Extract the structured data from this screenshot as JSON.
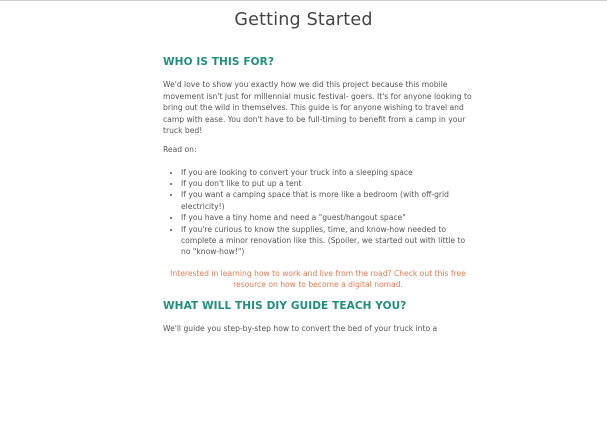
{
  "page": {
    "title": "Getting Started"
  },
  "section1": {
    "heading": "WHO IS THIS FOR?",
    "intro": "We'd love to show you exactly how we did this project because this mobile movement isn't just for millennial music festival- goers. It's for anyone looking to bring out the wild in themselves. This guide is for anyone wishing to travel and camp with ease. You don't have to be full-timing to benefit from a camp in your truck bed!",
    "read_on": "Read on:",
    "bullets": [
      "If you are looking to convert your truck into a sleeping space",
      "If you don't like to put up a tent",
      "If you want a camping space that is more like a bedroom (with off-grid electricity!)",
      "If you have a tiny home and need a \"guest/hangout space\"",
      "If you're curious to know the supplies, time, and know-how needed to complete a minor renovation like this. (Spoiler, we started out with little to no \"know-how!\")"
    ],
    "promo_link": "Interested in learning how to work and live from the road? Check out this free resource on how to become a digital nomad."
  },
  "section2": {
    "heading": "WHAT WILL THIS DIY GUIDE TEACH YOU?",
    "intro": "We'll guide you step-by-step how to convert the bed of your truck into a"
  },
  "colors": {
    "heading_teal": "#1f8f7f",
    "link_orange": "#e07a52",
    "body_text": "#555555"
  }
}
